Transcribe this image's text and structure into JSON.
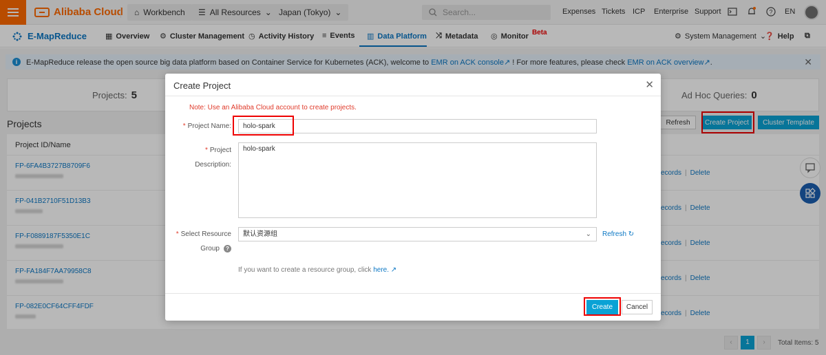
{
  "topbar": {
    "brand": "Alibaba Cloud",
    "workbench": "Workbench",
    "resources": "All Resources",
    "region": "Japan (Tokyo)",
    "search_placeholder": "Search...",
    "links": [
      "Expenses",
      "Tickets",
      "ICP",
      "Enterprise",
      "Support"
    ],
    "lang": "EN"
  },
  "navbar": {
    "product": "E-MapReduce",
    "items": [
      "Overview",
      "Cluster Management",
      "Activity History",
      "Events",
      "Data Platform",
      "Metadata",
      "Monitor"
    ],
    "beta": "Beta",
    "system_management": "System Management",
    "help": "Help"
  },
  "notice": {
    "text1": "E-MapReduce release the open source big data platform based on Container Service for Kubernetes (ACK), welcome to",
    "link1": "EMR on ACK console",
    "text2": "! For more features, please check",
    "link2": "EMR on ACK overview",
    "text3": "."
  },
  "stats": {
    "projects_label": "Projects:",
    "projects_value": "5",
    "adhoc_label": "Ad Hoc Queries:",
    "adhoc_value": "0"
  },
  "projects": {
    "title": "Projects",
    "column_id": "Project ID/Name",
    "refresh": "Refresh",
    "create": "Create Project",
    "template": "Cluster Template",
    "rows": [
      {
        "id": "FP-6FA4B3727B8709F6"
      },
      {
        "id": "FP-041B2710F51D13B3"
      },
      {
        "id": "FP-F0889187F5350E1C"
      },
      {
        "id": "FP-FA184F7AA79958C8"
      },
      {
        "id": "FP-082E0CF64CFF4FDF"
      }
    ],
    "action_records": "ecords",
    "action_delete": "Delete",
    "pager_current": "1",
    "total": "Total Items: 5"
  },
  "modal": {
    "title": "Create Project",
    "note": "Note: Use an Alibaba Cloud account to create projects.",
    "name_label": "Project Name:",
    "name_value": "holo-spark",
    "desc_label_1": "Project",
    "desc_label_2": "Description:",
    "desc_value": "holo-spark",
    "rg_label_1": "Select Resource",
    "rg_label_2": "Group",
    "rg_value": "默认资源组",
    "rg_refresh": "Refresh",
    "rg_hint": "If you want to create a resource group, click",
    "rg_hint_link": "here.",
    "create": "Create",
    "cancel": "Cancel"
  },
  "colors": {
    "brand_orange": "#ff6a00",
    "primary_blue": "#0aa2d5",
    "link_blue": "#0b77c4",
    "highlight_red": "#ee0000"
  }
}
